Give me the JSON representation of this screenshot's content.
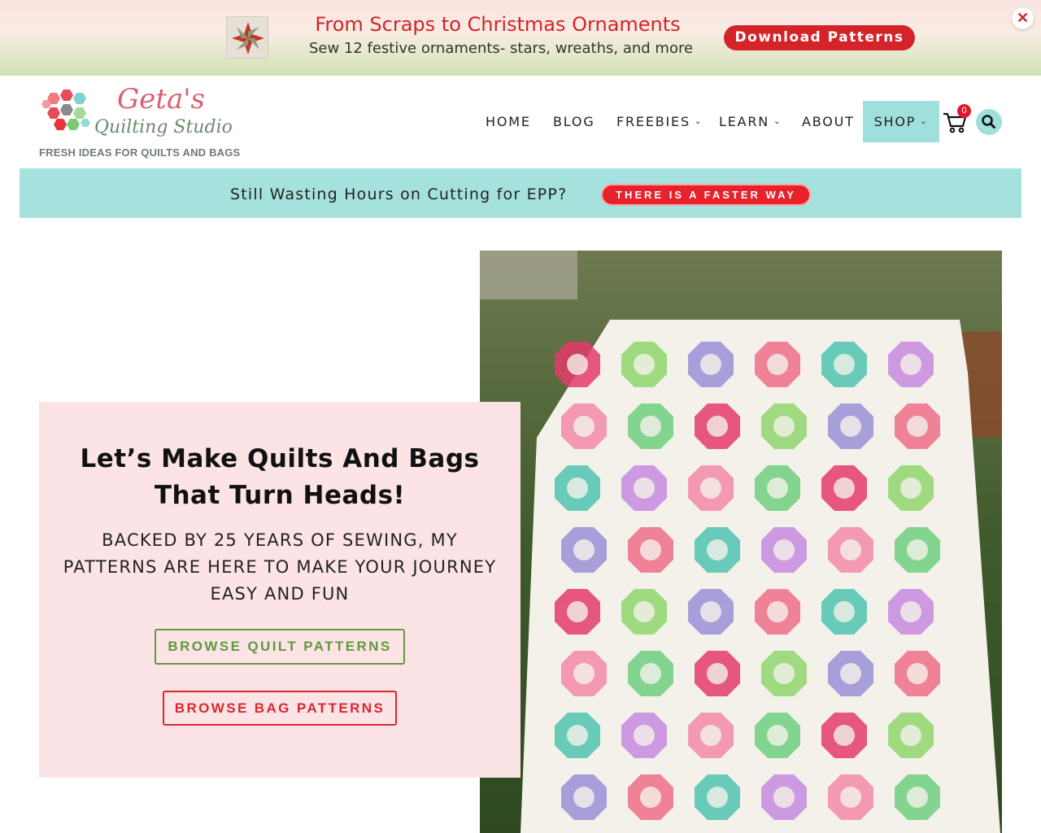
{
  "promo": {
    "title": "From Scraps to Christmas Ornaments",
    "subtitle": "Sew 12 festive ornaments- stars, wreaths, and more",
    "button_label": "Download Patterns",
    "close_label": "✕"
  },
  "logo": {
    "name_line1": "Geta's",
    "name_line2": "Quilting Studio",
    "tagline": "FRESH IDEAS FOR QUILTS AND BAGS"
  },
  "nav": {
    "items": [
      {
        "label": "HOME"
      },
      {
        "label": "BLOG"
      },
      {
        "label": "FREEBIES"
      },
      {
        "label": "LEARN"
      },
      {
        "label": "ABOUT"
      },
      {
        "label": "SHOP"
      }
    ],
    "cart_count": "0"
  },
  "epp_banner": {
    "text": "Still Wasting Hours on Cutting for EPP?",
    "button_label": "THERE IS A FASTER WAY"
  },
  "hero": {
    "title": "Let’s Make Quilts And Bags That Turn Heads!",
    "subtitle": "BACKED BY 25 YEARS OF SEWING, MY PATTERNS ARE HERE TO MAKE YOUR JOURNEY EASY AND FUN",
    "quilt_button": "BROWSE QUILT PATTERNS",
    "bag_button": "BROWSE BAG PATTERNS"
  },
  "colors": {
    "brand_red": "#d5232a",
    "brand_teal": "#a5e2dd",
    "brand_green": "#5d9a3d",
    "hero_card_pink": "#fce4e6"
  }
}
